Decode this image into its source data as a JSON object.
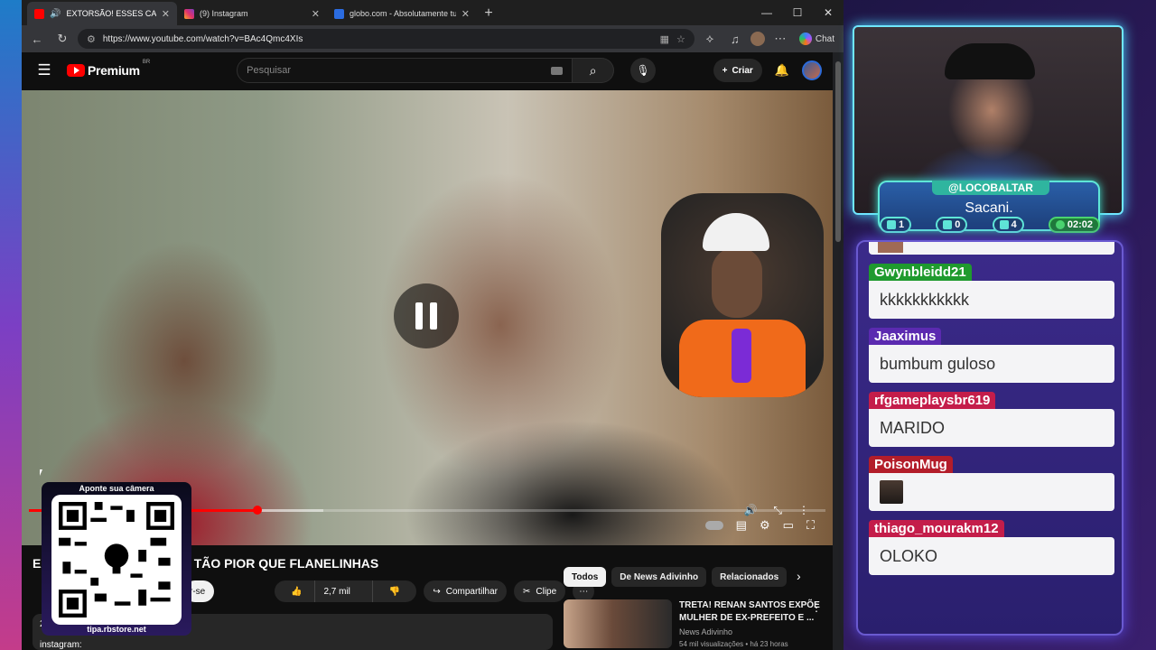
{
  "browser": {
    "tabs": [
      {
        "title": "EXTORSÃO! ESSES CARAS TÃO",
        "icon": "youtube-audio-icon",
        "color": "#ff0000"
      },
      {
        "title": "(9) Instagram",
        "icon": "instagram-icon",
        "color": "#e1306c"
      },
      {
        "title": "globo.com - Absolutamente tudo",
        "icon": "globo-icon",
        "color": "#2b6ce0"
      }
    ],
    "url": "https://www.youtube.com/watch?v=BAc4Qmc4XIs",
    "chat_label": "Chat"
  },
  "youtube": {
    "brand": "Premium",
    "region": "BR",
    "search_placeholder": "Pesquisar",
    "create_label": "Criar",
    "video_title_left": "EX",
    "video_title_right": "TÃO PIOR QUE FLANELINHAS",
    "subscribe_label": "r-se",
    "like_count": "2,7 mil",
    "share_label": "Compartilhar",
    "clip_label": "Clipe",
    "desc_line1": "2",
    "desc_line2": "instagram:",
    "progress": {
      "played": 0.287,
      "buffered": 0.37
    },
    "chips": [
      "Todos",
      "De News Adivinho",
      "Relacionados"
    ],
    "related": {
      "title": "TRETA! RENAN SANTOS EXPÕE MULHER DE EX-PREFEITO E ...",
      "channel": "News Adivinho",
      "meta": "54 mil visualizações • há 23 horas"
    }
  },
  "qr_overlay": {
    "header": "Aponte sua câmera",
    "footer": "tipa.rbstore.net"
  },
  "stream": {
    "handle": "@LOCOBALTAR",
    "name": "Sacani.",
    "stats": {
      "chat": "1",
      "youtube": "0",
      "twitch": "4",
      "time": "02:02"
    },
    "colors": {
      "accent_cyan": "#6fe7ff",
      "accent_teal": "#2fb59f",
      "panel": "#3b2a8a"
    }
  },
  "chat": {
    "messages": [
      {
        "user": "Gwynbleidd21",
        "text": "kkkkkkkkkkk",
        "color": "#1f9a2e",
        "emote": false
      },
      {
        "user": "Jaaximus",
        "text": "bumbum guloso",
        "color": "#5b2ab0",
        "emote": false
      },
      {
        "user": "rfgameplaysbr619",
        "text": "MARIDO",
        "color": "#c41d4a",
        "emote": false
      },
      {
        "user": "PoisonMug",
        "text": "",
        "color": "#b31d2a",
        "emote": true
      },
      {
        "user": "thiago_mourakm12",
        "text": "OLOKO",
        "color": "#c41d4a",
        "emote": false
      }
    ]
  }
}
